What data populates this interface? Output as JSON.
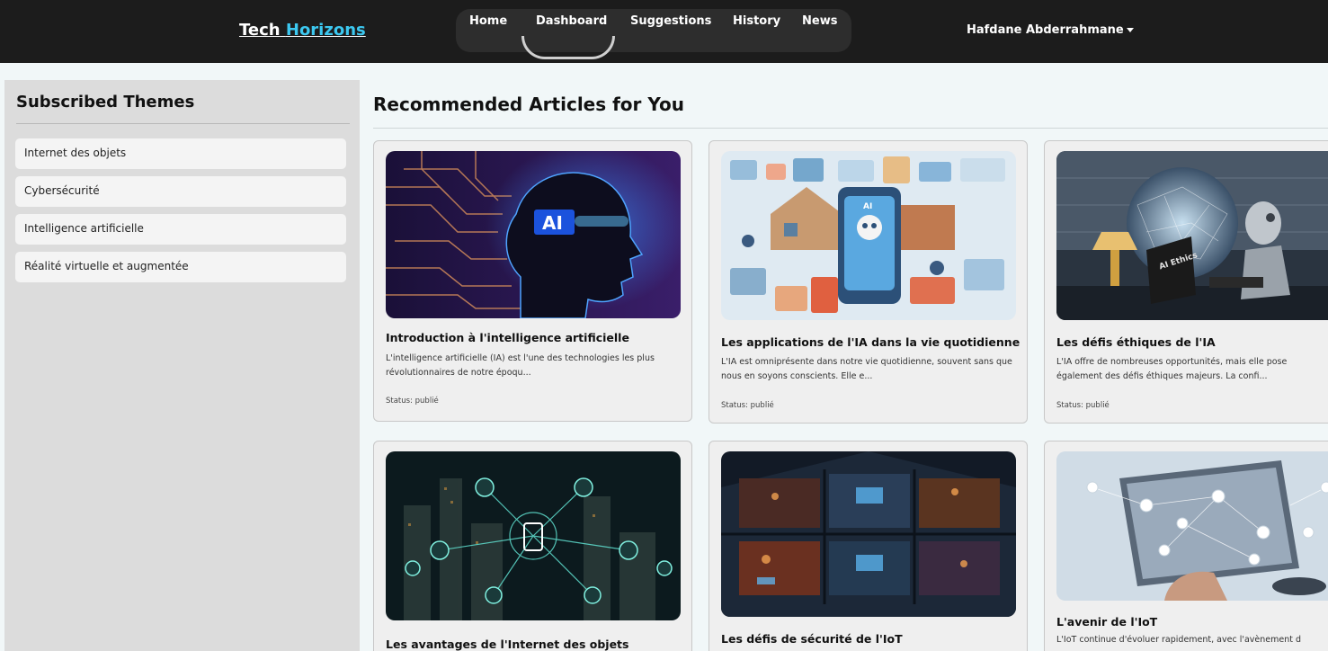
{
  "header": {
    "brand_part1": "Tech",
    "brand_part2": "Horizons",
    "nav": [
      "Home",
      "Dashboard",
      "Suggestions",
      "History",
      "News"
    ],
    "active_nav": "Dashboard",
    "user_name": "Hafdane Abderrahmane",
    "user_caret_icon": "caret-down-icon"
  },
  "sidebar": {
    "title": "Subscribed Themes",
    "items": [
      {
        "label": "Internet des objets"
      },
      {
        "label": "Cybersécurité"
      },
      {
        "label": "Intelligence artificielle"
      },
      {
        "label": "Réalité virtuelle et augmentée"
      }
    ]
  },
  "main": {
    "title": "Recommended Articles for You",
    "articles": [
      {
        "title": "Introduction à l'intelligence artificielle",
        "excerpt": "L'intelligence artificielle (IA) est l'une des technologies les plus révolutionnaires de notre époqu...",
        "status": "Status: publié",
        "image_text": "AI"
      },
      {
        "title": "Les applications de l'IA dans la vie quotidienne",
        "excerpt": "L'IA est omniprésente dans notre vie quotidienne, souvent sans que nous en soyons conscients. Elle e...",
        "status": "Status: publié",
        "image_text": "AI"
      },
      {
        "title": "Les défis éthiques de l'IA",
        "excerpt": "L'IA offre de nombreuses opportunités, mais elle pose également des défis éthiques majeurs. La confi...",
        "status": "Status: publié",
        "image_text": "AI Ethics"
      },
      {
        "title": "Les avantages de l'Internet des objets",
        "excerpt": "",
        "status": ""
      },
      {
        "title": "Les défis de sécurité de l'IoT",
        "excerpt": "",
        "status": ""
      },
      {
        "title": "L'avenir de l'IoT",
        "excerpt": "L'IoT continue d'évoluer rapidement, avec l'avènement d",
        "status": ""
      }
    ]
  },
  "colors": {
    "header_bg": "#1c1c1c",
    "brand_accent": "#3cc8f0",
    "sidebar_bg": "#dcdcdc",
    "page_bg": "#f1f7f8"
  }
}
